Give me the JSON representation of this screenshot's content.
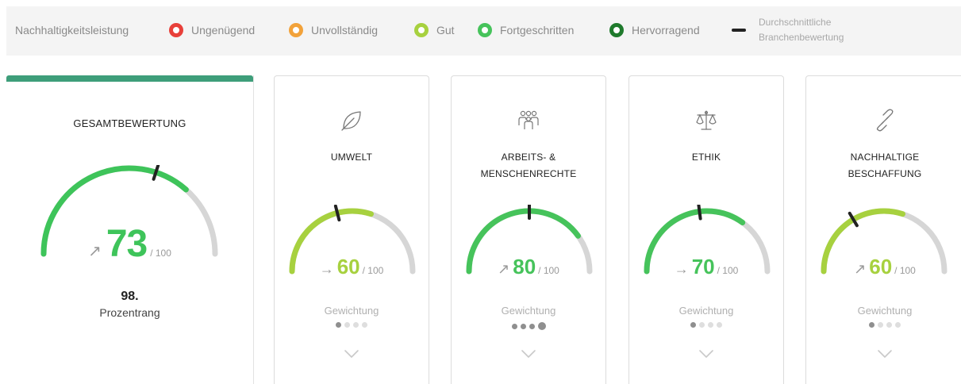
{
  "legend": {
    "title": "Nachhaltigkeitsleistung",
    "items": [
      {
        "label": "Ungenügend",
        "color": "#e8403a"
      },
      {
        "label": "Unvollständig",
        "color": "#f2a23a"
      },
      {
        "label": "Gut",
        "color": "#a7d13f"
      },
      {
        "label": "Fortgeschritten",
        "color": "#46c35b"
      },
      {
        "label": "Hervorragend",
        "color": "#1f7a2c"
      }
    ],
    "average_label_line1": "Durchschnittliche",
    "average_label_line2": "Branchenbewertung"
  },
  "overall": {
    "accent_color": "#3e9e7a",
    "title": "GESAMTBEWERTUNG",
    "trend_symbol": "↗",
    "score": 73,
    "score_max": "/ 100",
    "score_color": "#3ec45a",
    "industry_average": 60,
    "rank_value": "98.",
    "rank_label": "Prozentrang"
  },
  "categories": [
    {
      "icon": "leaf-icon",
      "title_line1": "UMWELT",
      "title_line2": "",
      "trend_symbol": "→",
      "score": 60,
      "score_max": "/ 100",
      "color": "#a7d13f",
      "industry_average": 42,
      "weight_label": "Gewichtung",
      "weight_level": 1
    },
    {
      "icon": "people-icon",
      "title_line1": "ARBEITS- &",
      "title_line2": "MENSCHENRECHTE",
      "trend_symbol": "↗",
      "score": 80,
      "score_max": "/ 100",
      "color": "#46c35b",
      "industry_average": 50,
      "weight_label": "Gewichtung",
      "weight_level": 4
    },
    {
      "icon": "scales-icon",
      "title_line1": "ETHIK",
      "title_line2": "",
      "trend_symbol": "→",
      "score": 70,
      "score_max": "/ 100",
      "color": "#46c35b",
      "industry_average": 46,
      "weight_label": "Gewichtung",
      "weight_level": 1
    },
    {
      "icon": "link-icon",
      "title_line1": "NACHHALTIGE",
      "title_line2": "BESCHAFFUNG",
      "trend_symbol": "↗",
      "score": 60,
      "score_max": "/ 100",
      "color": "#a7d13f",
      "industry_average": 33,
      "weight_label": "Gewichtung",
      "weight_level": 1
    }
  ],
  "gauge_track_color": "#d6d6d6"
}
